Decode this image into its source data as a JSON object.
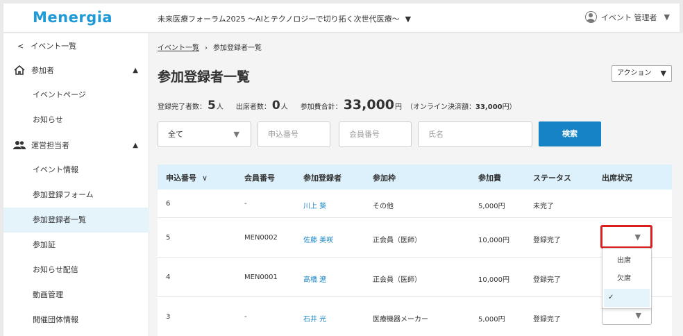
{
  "header": {
    "logo": "Menergia",
    "event_title": "未来医療フォーラム2025 ～AIとテクノロジーで切り拓く次世代医療～",
    "user_name": "イベント 管理者"
  },
  "sidebar": {
    "back_label": "イベント一覧",
    "participants_section": "参加者",
    "participants_items": [
      "イベントページ",
      "お知らせ"
    ],
    "staff_section": "運営担当者",
    "staff_items": [
      "イベント情報",
      "参加登録フォーム",
      "参加登録者一覧",
      "参加証",
      "お知らせ配信",
      "動画管理",
      "開催団体情報"
    ],
    "active_item": "参加登録者一覧"
  },
  "breadcrumb": {
    "parent": "イベント一覧",
    "current": "参加登録者一覧"
  },
  "page_title": "参加登録者一覧",
  "action_label": "アクション",
  "stats": {
    "registered_label": "登録完了者数：",
    "registered_value": "5",
    "registered_unit": "人",
    "attended_label": "出席者数：",
    "attended_value": "0",
    "attended_unit": "人",
    "fee_label": "参加費合計：",
    "fee_value": "33,000",
    "fee_unit": "円",
    "online_prefix": "（オンライン決済額：",
    "online_value": "33,000",
    "online_suffix": "円）"
  },
  "filters": {
    "status_select": "全て",
    "app_no_placeholder": "申込番号",
    "member_no_placeholder": "会員番号",
    "name_placeholder": "氏名",
    "search_label": "検索"
  },
  "table": {
    "headers": [
      "申込番号",
      "会員番号",
      "参加登録者",
      "参加枠",
      "参加費",
      "ステータス",
      "出席状況"
    ],
    "rows": [
      {
        "app_no": "6",
        "member_no": "-",
        "name": "川上 葵",
        "slot": "その他",
        "fee": "5,000円",
        "status": "未完了"
      },
      {
        "app_no": "5",
        "member_no": "MEN0002",
        "name": "佐藤 美咲",
        "slot": "正会員（医師）",
        "fee": "10,000円",
        "status": "登録完了"
      },
      {
        "app_no": "4",
        "member_no": "MEN0001",
        "name": "高橋 遼",
        "slot": "正会員（医師）",
        "fee": "10,000円",
        "status": "登録完了"
      },
      {
        "app_no": "3",
        "member_no": "-",
        "name": "石井 光",
        "slot": "医療機器メーカー",
        "fee": "5,000円",
        "status": "登録完了"
      }
    ]
  },
  "attendance_menu": {
    "options": [
      "出席",
      "欠席",
      ""
    ],
    "selected_mark": "✓"
  },
  "colors": {
    "brand": "#1f9ad6",
    "primary_button": "#1583c6",
    "link": "#1f88c6",
    "table_header": "#dcf1fb",
    "highlight": "#d9201f"
  }
}
